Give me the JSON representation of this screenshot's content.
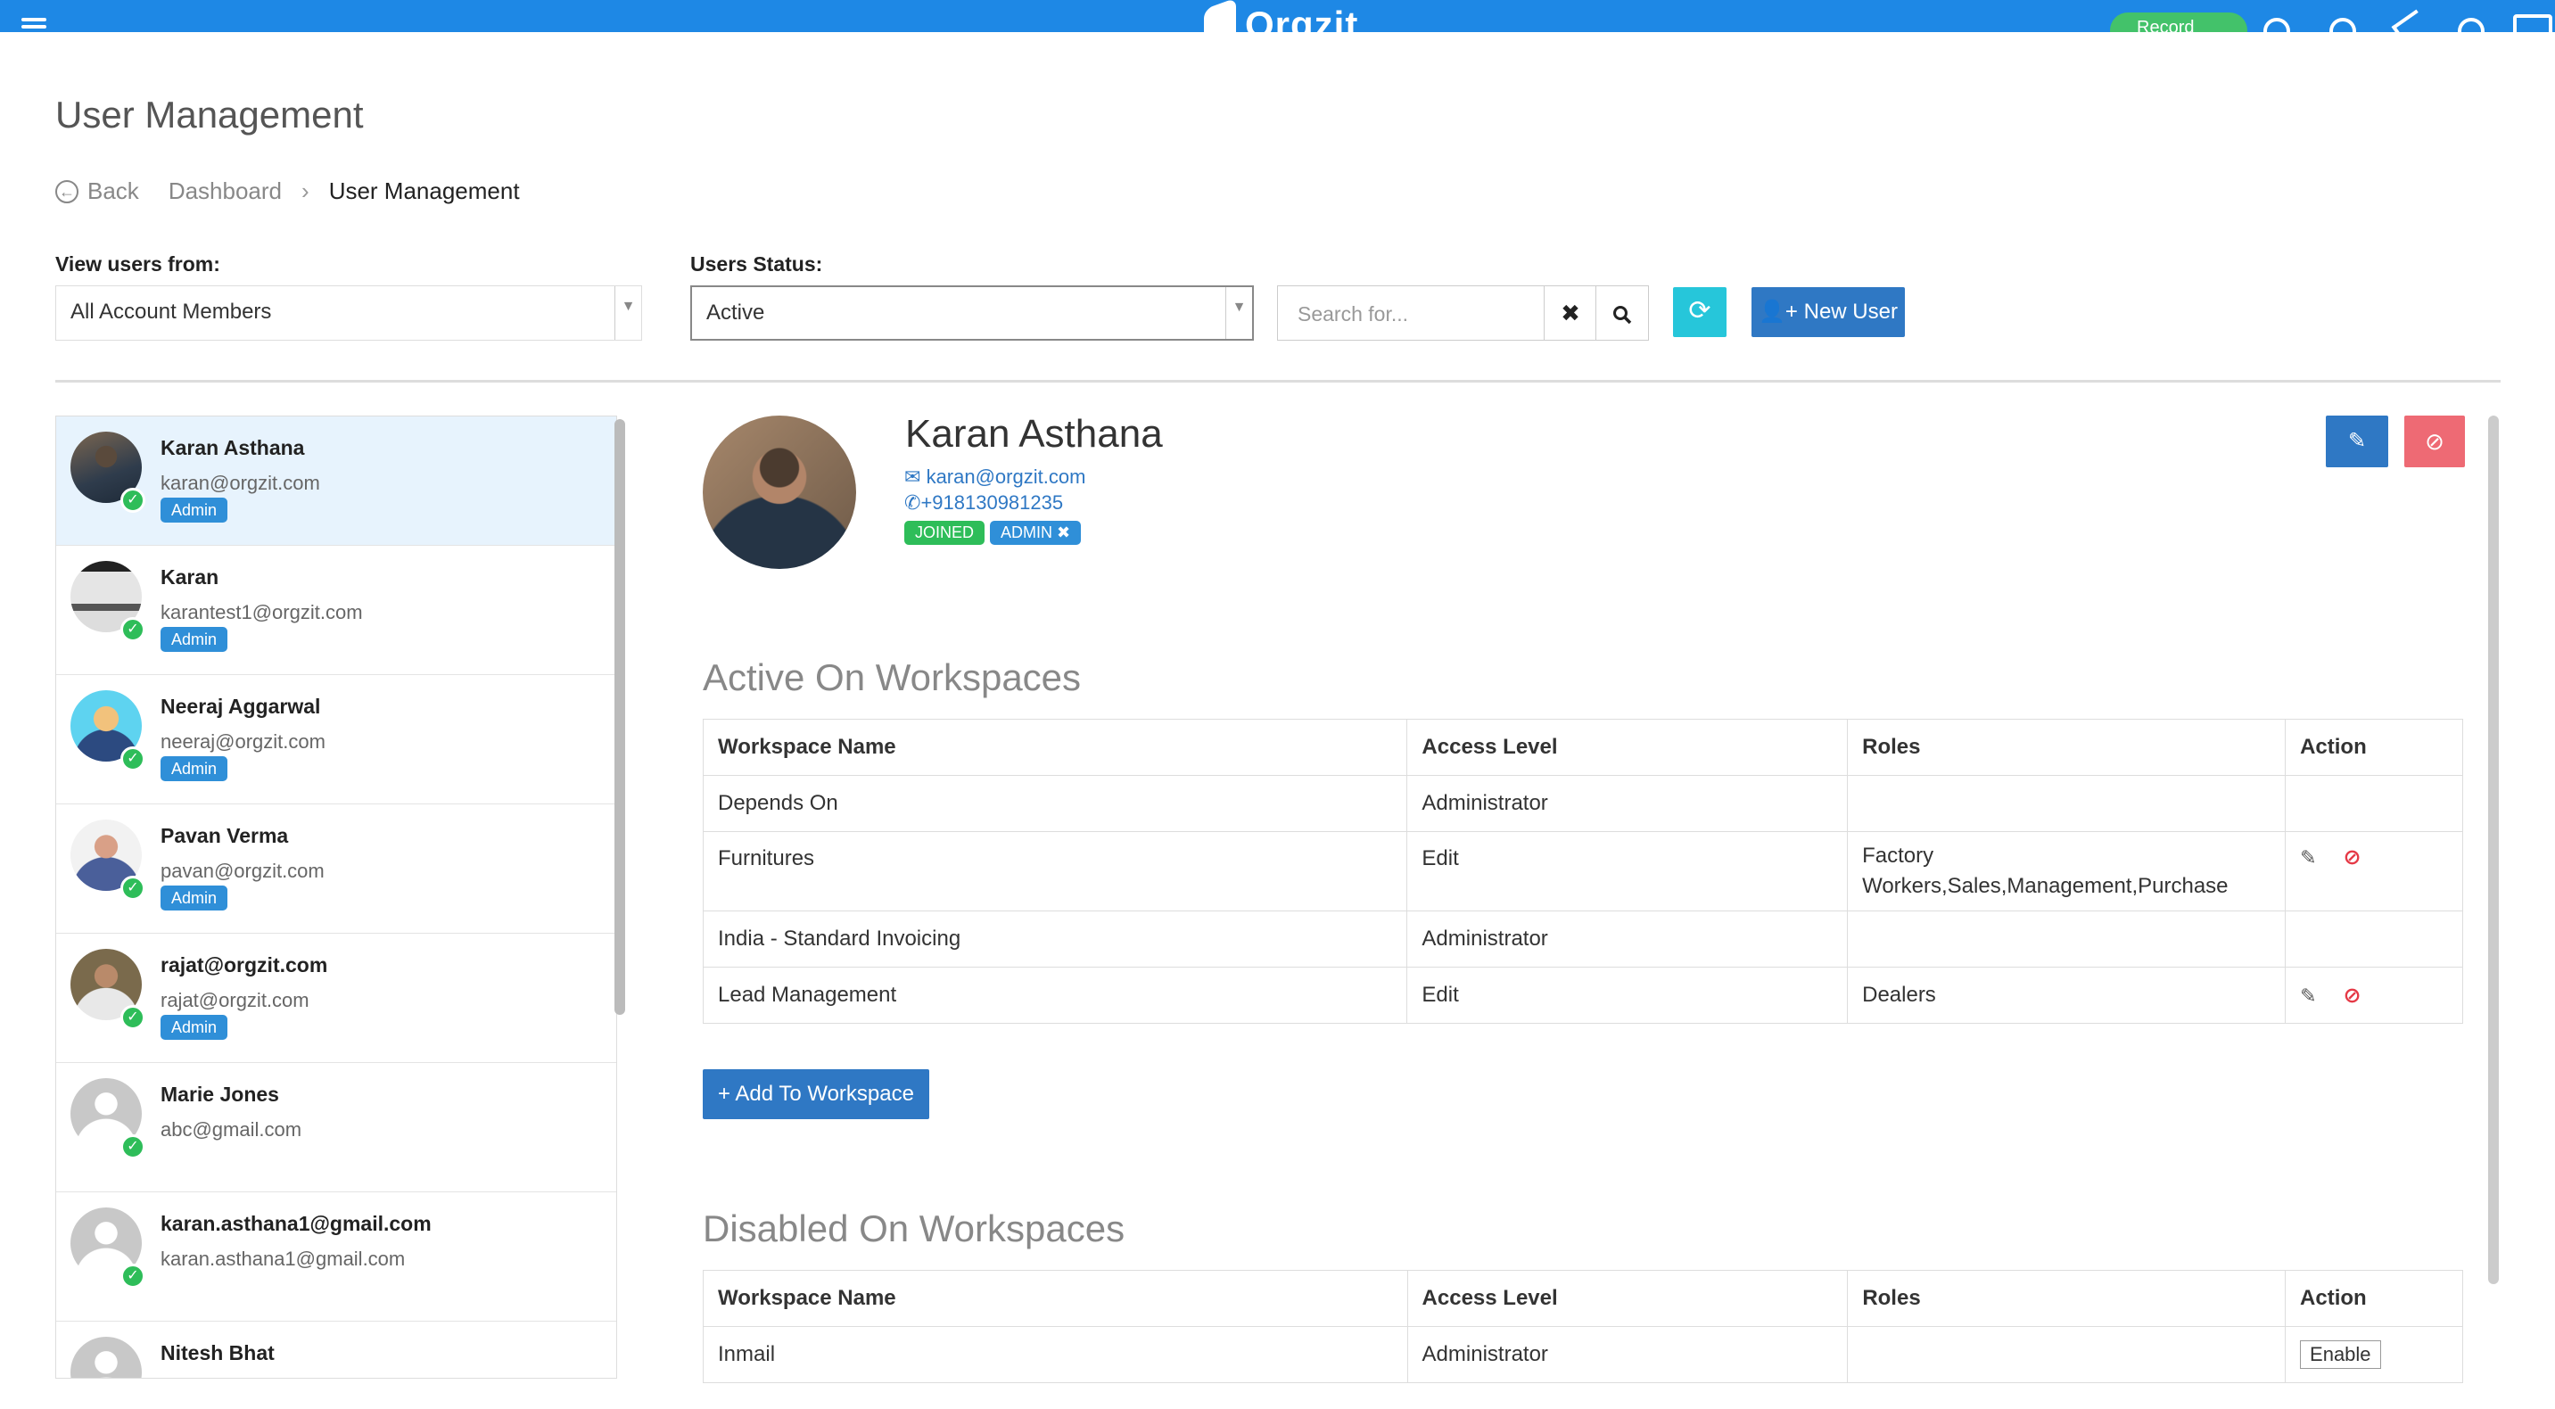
{
  "header": {
    "logo_text": "Orgzit",
    "pill_label": "Record"
  },
  "page": {
    "title": "User Management",
    "breadcrumb": {
      "back": "Back",
      "items": [
        "Dashboard",
        "User Management"
      ],
      "separator": "›"
    }
  },
  "filters": {
    "view_users_label": "View users from:",
    "view_users_value": "All Account Members",
    "status_label": "Users Status:",
    "status_value": "Active",
    "search_placeholder": "Search for...",
    "new_user_label": "New User"
  },
  "users": [
    {
      "name": "Karan Asthana",
      "email": "karan@orgzit.com",
      "badge": "Admin"
    },
    {
      "name": "Karan",
      "email": "karantest1@orgzit.com",
      "badge": "Admin"
    },
    {
      "name": "Neeraj Aggarwal",
      "email": "neeraj@orgzit.com",
      "badge": "Admin"
    },
    {
      "name": "Pavan Verma",
      "email": "pavan@orgzit.com",
      "badge": "Admin"
    },
    {
      "name": "rajat@orgzit.com",
      "email": "rajat@orgzit.com",
      "badge": "Admin"
    },
    {
      "name": "Marie Jones",
      "email": "abc@gmail.com",
      "badge": ""
    },
    {
      "name": "karan.asthana1@gmail.com",
      "email": "karan.asthana1@gmail.com",
      "badge": ""
    },
    {
      "name": "Nitesh Bhat",
      "email": "",
      "badge": ""
    }
  ],
  "profile": {
    "name": "Karan Asthana",
    "email": "karan@orgzit.com",
    "phone": "+918130981235",
    "status_tag": "JOINED",
    "role_tag": "ADMIN"
  },
  "active_workspaces": {
    "title": "Active On Workspaces",
    "headers": [
      "Workspace Name",
      "Access Level",
      "Roles",
      "Action"
    ],
    "rows": [
      {
        "name": "Depends On",
        "access": "Administrator",
        "roles": "",
        "actions": false
      },
      {
        "name": "Furnitures",
        "access": "Edit",
        "roles": "Factory Workers,Sales,Management,Purchase",
        "actions": true
      },
      {
        "name": "India - Standard Invoicing",
        "access": "Administrator",
        "roles": "",
        "actions": false
      },
      {
        "name": "Lead Management",
        "access": "Edit",
        "roles": "Dealers",
        "actions": true
      }
    ],
    "add_button": "Add To Workspace"
  },
  "disabled_workspaces": {
    "title": "Disabled On Workspaces",
    "headers": [
      "Workspace Name",
      "Access Level",
      "Roles",
      "Action"
    ],
    "rows": [
      {
        "name": "Inmail",
        "access": "Administrator",
        "roles": "",
        "action_label": "Enable"
      }
    ]
  }
}
